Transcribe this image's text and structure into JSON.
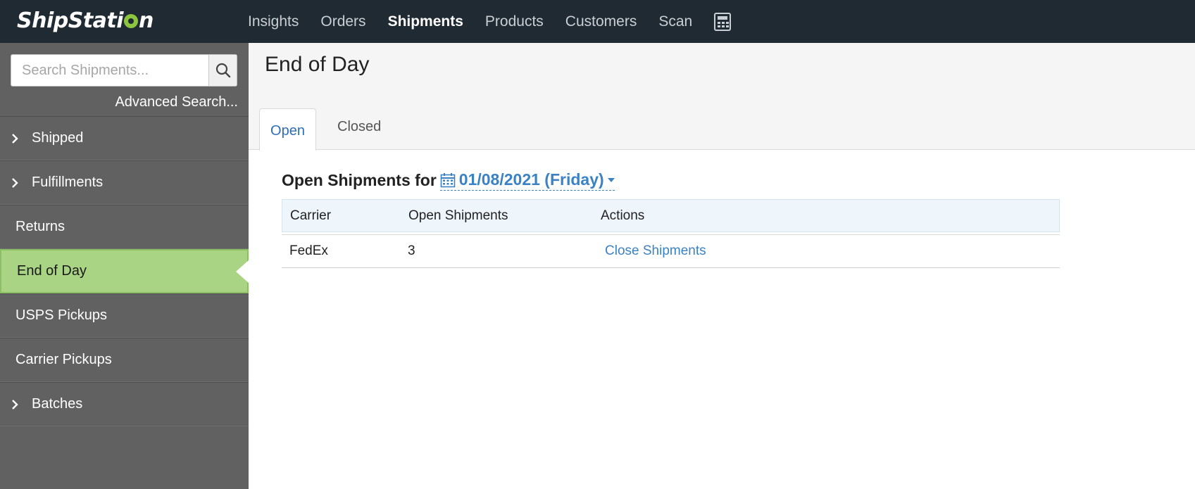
{
  "brand": {
    "logo_before": "ShipStati",
    "logo_after": "n"
  },
  "nav": {
    "items": [
      {
        "label": "Insights",
        "active": false
      },
      {
        "label": "Orders",
        "active": false
      },
      {
        "label": "Shipments",
        "active": true
      },
      {
        "label": "Products",
        "active": false
      },
      {
        "label": "Customers",
        "active": false
      },
      {
        "label": "Scan",
        "active": false
      }
    ],
    "calculator_icon": "calculator-icon"
  },
  "sidebar": {
    "search_placeholder": "Search Shipments...",
    "advanced_search": "Advanced Search...",
    "items": [
      {
        "label": "Shipped",
        "expandable": true,
        "active": false
      },
      {
        "label": "Fulfillments",
        "expandable": true,
        "active": false
      },
      {
        "label": "Returns",
        "expandable": false,
        "active": false
      },
      {
        "label": "End of Day",
        "expandable": false,
        "active": true
      },
      {
        "label": "USPS Pickups",
        "expandable": false,
        "active": false
      },
      {
        "label": "Carrier Pickups",
        "expandable": false,
        "active": false
      },
      {
        "label": "Batches",
        "expandable": true,
        "active": false
      }
    ]
  },
  "main": {
    "title": "End of Day",
    "tabs": [
      {
        "label": "Open",
        "active": true
      },
      {
        "label": "Closed",
        "active": false
      }
    ],
    "heading": "Open Shipments for",
    "date": "01/08/2021 (Friday)",
    "table": {
      "headers": [
        "Carrier",
        "Open Shipments",
        "Actions"
      ],
      "rows": [
        {
          "carrier": "FedEx",
          "open_shipments": "3",
          "action": "Close Shipments"
        }
      ]
    }
  },
  "colors": {
    "topbar": "#1f2a33",
    "sidebar": "#616161",
    "active_item": "#a9d484",
    "brand_green": "#8cc63f",
    "link": "#3b82c4"
  }
}
